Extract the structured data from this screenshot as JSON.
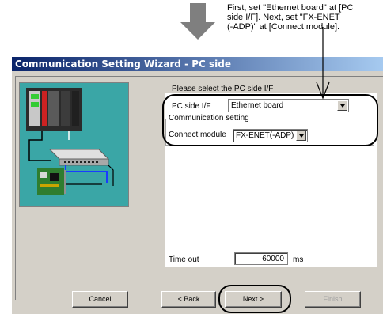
{
  "callout": {
    "lines": [
      "First, set \"Ethernet board\" at [PC",
      "side I/F]. Next, set \"FX-ENET",
      "(-ADP)\" at [Connect module]."
    ]
  },
  "window": {
    "title": "Communication Setting Wizard - PC side"
  },
  "form": {
    "heading": "Please select the PC side I/F",
    "pc_side_if_label": "PC side I/F",
    "pc_side_if_value": "Ethernet board",
    "comm_setting_label": "Communication setting",
    "connect_module_label": "Connect module",
    "connect_module_value": "FX-ENET(-ADP)",
    "timeout_label": "Time out",
    "timeout_value": "60000",
    "timeout_unit": "ms"
  },
  "buttons": {
    "cancel": "Cancel",
    "back": "< Back",
    "next": "Next >",
    "finish": "Finish"
  },
  "colors": {
    "title_gradient_start": "#0a246a",
    "title_gradient_end": "#a6caf0",
    "image_panel_bg": "#3aa6a6",
    "dialog_bg": "#d4d0c8"
  }
}
